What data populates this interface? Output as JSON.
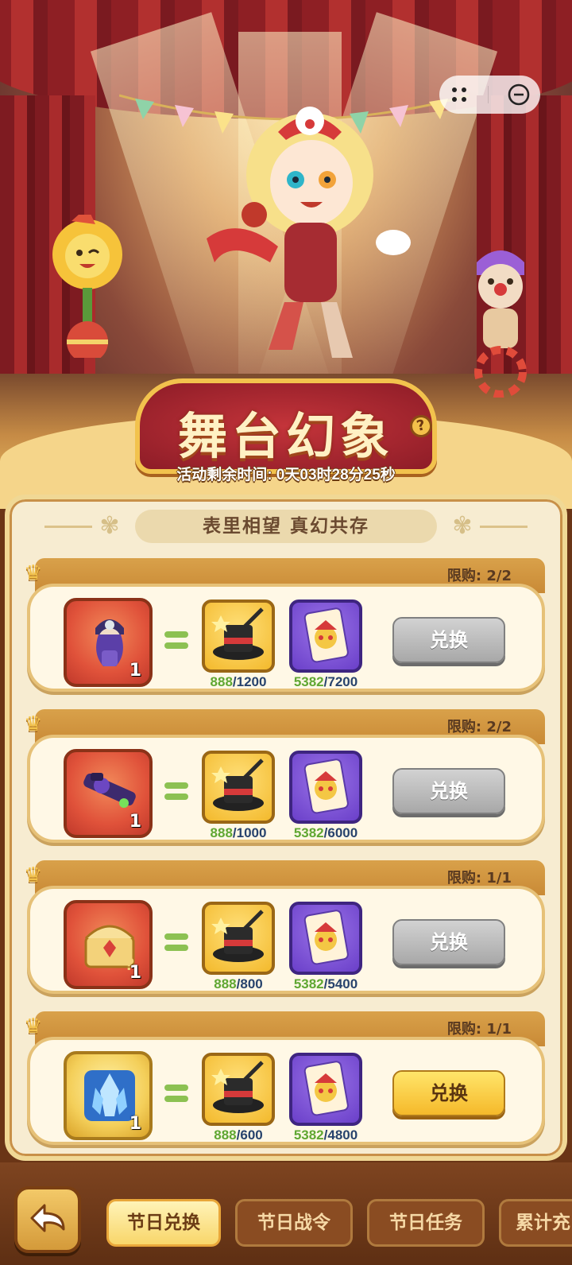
{
  "header": {
    "title": "舞台幻象",
    "help_icon": "?",
    "timer": "活动剩余时间: 0天03时28分25秒",
    "capsule_icons": [
      "more-dots-icon",
      "minimize-circle-icon"
    ]
  },
  "panel": {
    "slogan": "表里相望 真幻共存"
  },
  "cards": [
    {
      "limit": "限购: 2/2",
      "reward_icon": "clown-character-icon",
      "reward_count": "1",
      "reward_frame": "red",
      "cost1_have": "888",
      "cost1_need": "/1200",
      "cost2_have": "5382",
      "cost2_need": "/7200",
      "button": "兑换",
      "button_enabled": false
    },
    {
      "limit": "限购: 2/2",
      "reward_icon": "purple-blaster-weapon-icon",
      "reward_count": "1",
      "reward_frame": "red",
      "cost1_have": "888",
      "cost1_need": "/1000",
      "cost2_have": "5382",
      "cost2_need": "/6000",
      "button": "兑换",
      "button_enabled": false
    },
    {
      "limit": "限购: 1/1",
      "reward_icon": "mystery-treasure-chest-icon",
      "reward_count": "1",
      "reward_frame": "red",
      "cost1_have": "888",
      "cost1_need": "/800",
      "cost2_have": "5382",
      "cost2_need": "/5400",
      "button": "兑换",
      "button_enabled": false
    },
    {
      "limit": "限购: 1/1",
      "reward_icon": "blue-crystal-icon",
      "reward_count": "1",
      "reward_frame": "gold",
      "cost1_have": "888",
      "cost1_need": "/600",
      "cost2_have": "5382",
      "cost2_need": "/4800",
      "button": "兑换",
      "button_enabled": true
    }
  ],
  "cost_icons": [
    "magic-hat-icon",
    "jester-card-icon"
  ],
  "tabs": [
    {
      "label": "节日兑换",
      "active": true
    },
    {
      "label": "节日战令",
      "active": false
    },
    {
      "label": "节日任务",
      "active": false
    },
    {
      "label": "累计充",
      "active": false
    }
  ],
  "colors": {
    "have_amount": "#5fa732",
    "need_amount": "#27436d",
    "active_button": "#f5b92a",
    "disabled_button": "#a8a8a8"
  }
}
